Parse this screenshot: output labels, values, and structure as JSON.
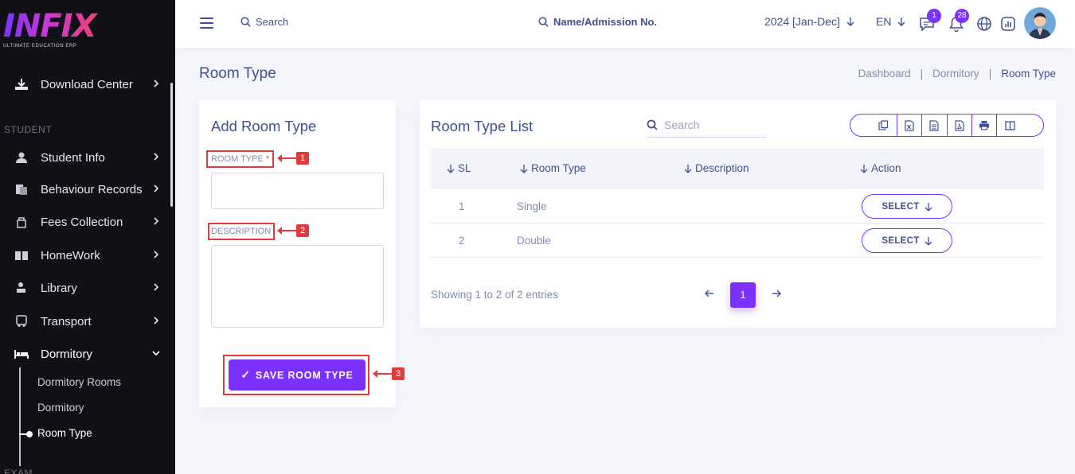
{
  "brand": {
    "logo_text": "INFIX",
    "tagline": "ULTIMATE EDUCATION ERP"
  },
  "sidebar": {
    "download_center": "Download Center",
    "section_student": "STUDENT",
    "items": [
      {
        "label": "Student Info",
        "icon": "student-icon"
      },
      {
        "label": "Behaviour Records",
        "icon": "records-icon"
      },
      {
        "label": "Fees Collection",
        "icon": "fees-icon"
      },
      {
        "label": "HomeWork",
        "icon": "book-icon"
      },
      {
        "label": "Library",
        "icon": "library-icon"
      },
      {
        "label": "Transport",
        "icon": "bus-icon"
      },
      {
        "label": "Dormitory",
        "icon": "bed-icon"
      }
    ],
    "dormitory_sub": [
      "Dormitory Rooms",
      "Dormitory",
      "Room Type"
    ],
    "section_exam": "EXAM"
  },
  "topbar": {
    "search_label": "Search",
    "name_search": "Name/Admission No.",
    "year": "2024 [Jan-Dec]",
    "lang": "EN",
    "chat_count": "1",
    "notif_count": "28"
  },
  "page": {
    "title": "Room Type",
    "breadcrumb": [
      "Dashboard",
      "Dormitory",
      "Room Type"
    ]
  },
  "form": {
    "title": "Add Room Type",
    "room_type_label": "ROOM TYPE",
    "required_mark": "*",
    "description_label": "DESCRIPTION",
    "room_type_value": "",
    "description_value": "",
    "save_label": "SAVE ROOM TYPE",
    "save_check": "✓",
    "markers": [
      "1",
      "2",
      "3"
    ]
  },
  "list": {
    "title": "Room Type List",
    "search_placeholder": "Search",
    "columns": [
      "SL",
      "Room Type",
      "Description",
      "Action"
    ],
    "rows": [
      {
        "sl": "1",
        "room_type": "Single",
        "description": "",
        "action": "SELECT"
      },
      {
        "sl": "2",
        "room_type": "Double",
        "description": "",
        "action": "SELECT"
      }
    ],
    "showing": "Showing 1 to 2 of 2 entries",
    "current_page": "1"
  },
  "colors": {
    "accent": "#7c32ff",
    "sidebar_bg": "#111017",
    "text": "#415094",
    "muted": "#828bb2",
    "marker": "#e23b3b"
  }
}
